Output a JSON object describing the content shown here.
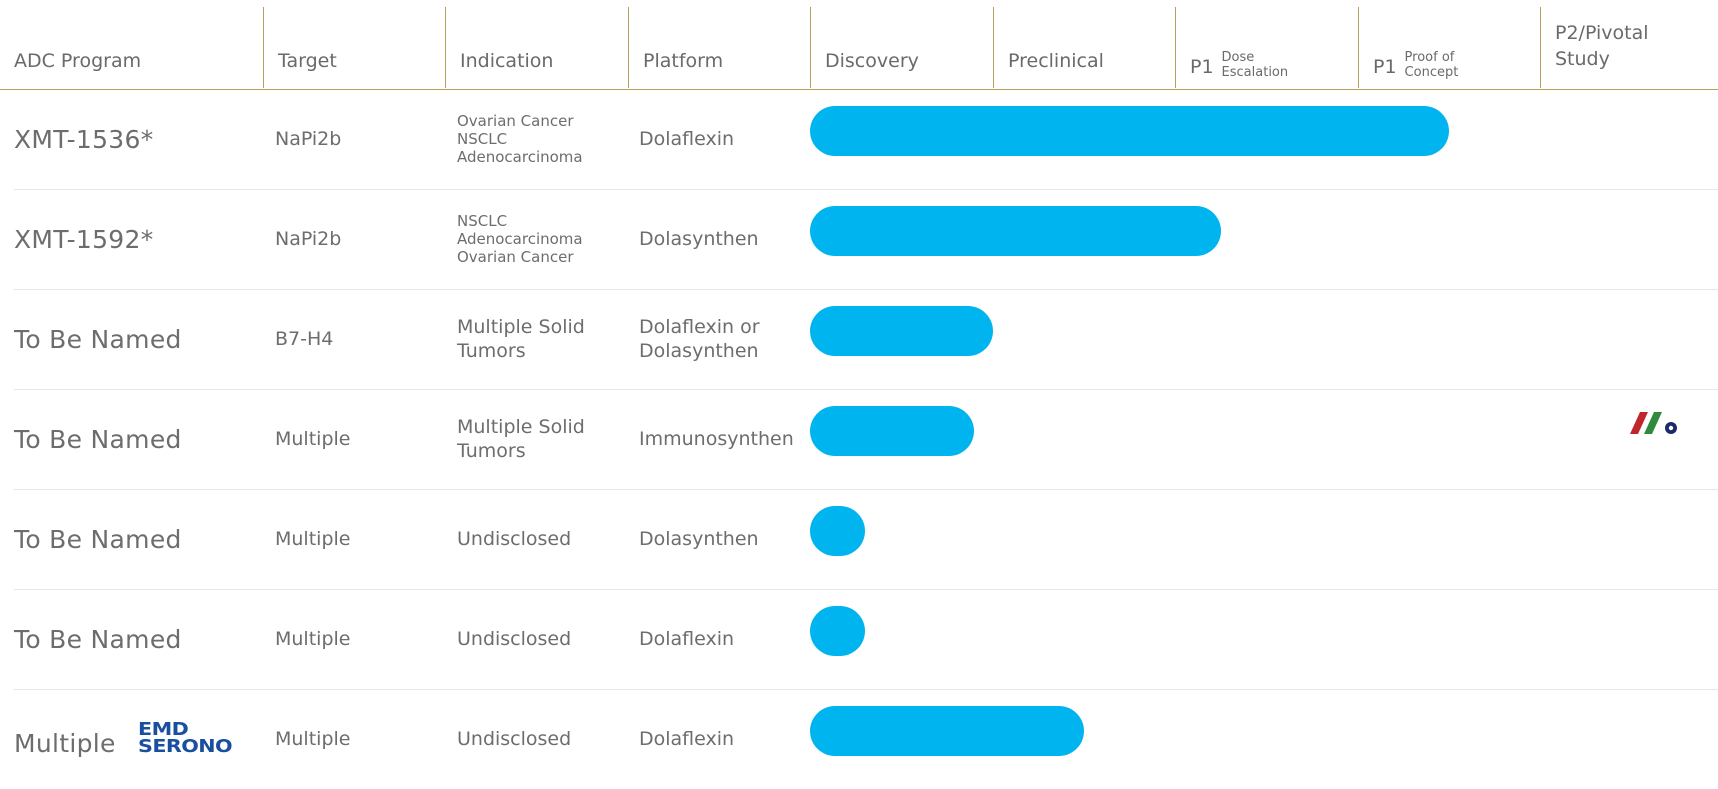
{
  "chart_data": {
    "type": "bar",
    "orientation": "horizontal",
    "stages": [
      "Discovery",
      "Preclinical",
      "P1 Dose Escalation",
      "P1 Proof of Concept",
      "P2/Pivotal Study"
    ],
    "xlim": [
      0,
      5
    ],
    "categories": [
      "XMT-1536*",
      "XMT-1592*",
      "To Be Named",
      "To Be Named",
      "To Be Named",
      "To Be Named",
      "Multiple"
    ],
    "values": [
      3.5,
      2.25,
      1.0,
      0.9,
      0.3,
      0.3,
      1.5
    ],
    "series": [
      {
        "values": [
          3.5,
          2.25,
          1.0,
          0.9,
          0.3,
          0.3,
          1.5
        ]
      }
    ],
    "bar_color": "#00b5ef",
    "grid": false,
    "legend": "none"
  },
  "header": {
    "col_program": "ADC Program",
    "col_target": "Target",
    "col_indication": "Indication",
    "col_platform": "Platform",
    "col_discovery": "Discovery",
    "col_preclinical": "Preclinical",
    "col_p1a_main": "P1",
    "col_p1a_sub1": "Dose",
    "col_p1a_sub2": "Escalation",
    "col_p1b_main": "P1",
    "col_p1b_sub1": "Proof of",
    "col_p1b_sub2": "Concept",
    "col_p2_line1": "P2/Pivotal",
    "col_p2_line2": "Study"
  },
  "rows": [
    {
      "program": "XMT-1536*",
      "target": "NaPi2b",
      "indication": [
        "Ovarian Cancer",
        "NSCLC",
        "Adenocarcinoma"
      ],
      "platform": [
        "Dolaflexin"
      ]
    },
    {
      "program": "XMT-1592*",
      "target": "NaPi2b",
      "indication": [
        "NSCLC",
        "Adenocarcinoma",
        "Ovarian Cancer"
      ],
      "platform": [
        "Dolasynthen"
      ]
    },
    {
      "program": "To Be Named",
      "target": "B7-H4",
      "indication": [
        "Multiple Solid",
        "Tumors"
      ],
      "platform": [
        "Dolaflexin or",
        "Dolasynthen"
      ]
    },
    {
      "program": "To Be Named",
      "target": "Multiple",
      "indication": [
        "Multiple Solid",
        "Tumors"
      ],
      "platform": [
        "Immunosynthen"
      ]
    },
    {
      "program": "To Be Named",
      "target": "Multiple",
      "indication": [
        "Undisclosed"
      ],
      "platform": [
        "Dolasynthen"
      ]
    },
    {
      "program": "To Be Named",
      "target": "Multiple",
      "indication": [
        "Undisclosed"
      ],
      "platform": [
        "Dolaflexin"
      ]
    },
    {
      "program": "Multiple",
      "partner_logo_text": [
        "EMD",
        "SERONO"
      ],
      "target": "Multiple",
      "indication": [
        "Undisclosed"
      ],
      "platform": [
        "Dolaflexin"
      ]
    }
  ],
  "partner_logo": {
    "icon": "mersana-logo-icon",
    "colors": [
      "#c0272d",
      "#2e8b3e",
      "#1b2a6b"
    ]
  }
}
